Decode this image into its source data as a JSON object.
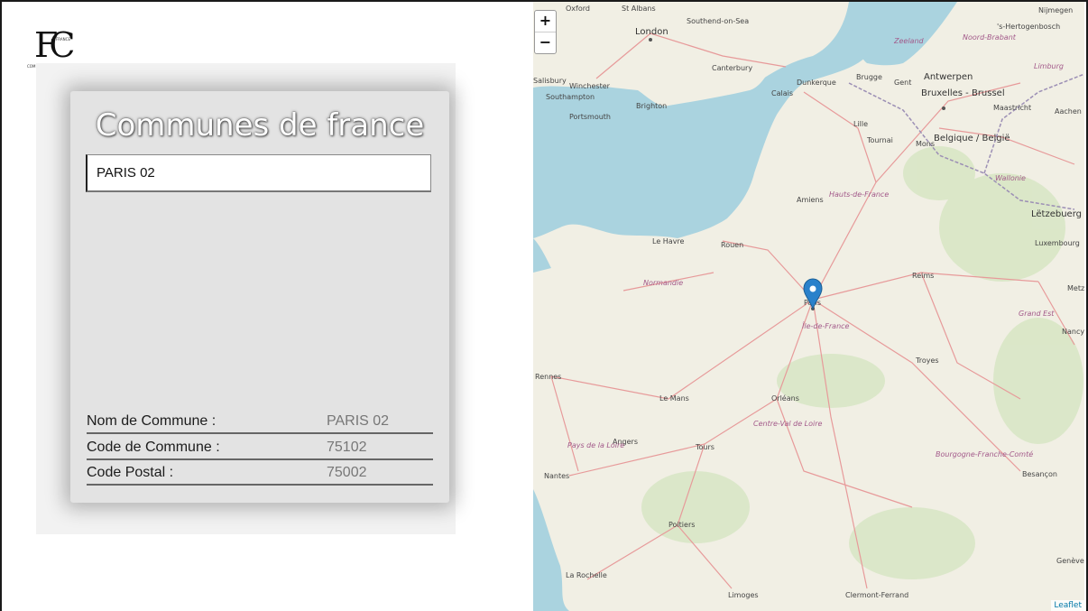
{
  "brand": {
    "logo_letters": "FC",
    "logo_sub_top": "FRANCE",
    "logo_sub_bottom": "COM"
  },
  "card": {
    "title": "Communes de france",
    "search_value": "PARIS 02",
    "rows": [
      {
        "label": "Nom de Commune :",
        "value": "PARIS 02"
      },
      {
        "label": "Code de Commune :",
        "value": "75102"
      },
      {
        "label": "Code Postal :",
        "value": "75002"
      }
    ]
  },
  "map": {
    "zoom_in": "+",
    "zoom_out": "−",
    "attribution": "Leaflet",
    "colors": {
      "sea": "#aad3df",
      "land": "#f1efe4",
      "forest": "#cfe2b9",
      "roads": "#e79a9a",
      "boundary": "#9c8fb5",
      "marker": "#2a81cb"
    },
    "places": {
      "oxford": "Oxford",
      "st_albans": "St Albans",
      "southend": "Southend-on-Sea",
      "london": "London",
      "canterbury": "Canterbury",
      "salisbury": "Salisbury",
      "winchester": "Winchester",
      "southampton": "Southampton",
      "portsmouth": "Portsmouth",
      "brighton": "Brighton",
      "dunkerque": "Dunkerque",
      "calais": "Calais",
      "bruges": "Brugge",
      "gent": "Gent",
      "antwerpen": "Antwerpen",
      "bruxelles": "Bruxelles - Brussel",
      "lille": "Lille",
      "tournai": "Tournai",
      "mons": "Mons",
      "belgique": "Belgique / België",
      "nijmegen": "Nijmegen",
      "hertogenbosch": "'s-Hertogenbosch",
      "zeeland": "Zeeland",
      "noord_brabant": "Noord-Brabant",
      "limburg": "Limburg",
      "maastricht": "Maastricht",
      "aachen": "Aachen",
      "wallonie": "Wallonie",
      "letzebuerg": "Lëtzebuerg",
      "luxembourg": "Luxembourg",
      "amiens": "Amiens",
      "hauts_de_france": "Hauts-de-France",
      "le_havre": "Le Havre",
      "rouen": "Rouen",
      "normandie": "Normandie",
      "reims": "Reims",
      "paris": "Paris",
      "ile_de_france": "Île-de-France",
      "metz": "Metz",
      "grand_est": "Grand Est",
      "nancy": "Nancy",
      "troyes": "Troyes",
      "rennes": "Rennes",
      "le_mans": "Le Mans",
      "orleans": "Orléans",
      "centre": "Centre-Val de Loire",
      "angers": "Angers",
      "pays_de_la_loire": "Pays de la Loire",
      "tours": "Tours",
      "nantes": "Nantes",
      "bourgogne": "Bourgogne-Franche-Comté",
      "besancon": "Besançon",
      "poitiers": "Poitiers",
      "la_rochelle": "La Rochelle",
      "limoges": "Limoges",
      "clermont": "Clermont-Ferrand",
      "geneve": "Genève"
    }
  }
}
